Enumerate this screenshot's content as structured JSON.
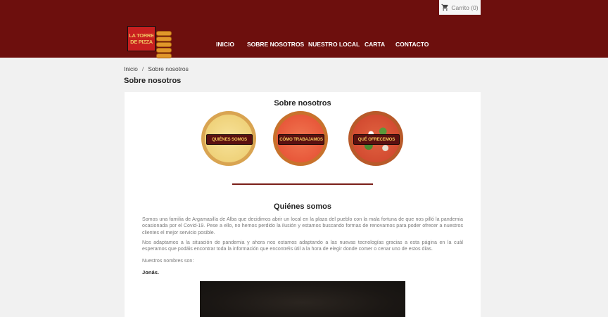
{
  "header": {
    "cart_label": "Carrito (0)",
    "cart_icon": "shopping-cart-icon",
    "logo_line1": "LA TORRE",
    "logo_line2": "DE PIZZA",
    "background_color": "#6d0f0d"
  },
  "nav": {
    "items": [
      {
        "label": "INICIO"
      },
      {
        "label": "SOBRE NOSOTROS"
      },
      {
        "label": "NUESTRO LOCAL"
      },
      {
        "label": "CARTA"
      },
      {
        "label": "CONTACTO"
      }
    ]
  },
  "breadcrumb": {
    "home": "Inicio",
    "separator": "/",
    "current": "Sobre nosotros"
  },
  "page": {
    "title": "Sobre nosotros"
  },
  "content": {
    "heading": "Sobre nosotros",
    "buttons": [
      {
        "label": "QUIÉNES SOMOS"
      },
      {
        "label": "CÓMO TRABAJAMOS"
      },
      {
        "label": "QUÉ OFRECEMOS"
      }
    ],
    "section_title": "Quiénes somos",
    "paragraph1": "Somos una familia de Argamasilla de Alba que decidimos abrir un local en la plaza del pueblo con la mala fortuna de que nos pilló la pandemia ocasionada por el Covid-19. Pese a ello, no hemos perdido la ilusión y estamos buscando formas de renovarnos para poder ofrecer a nuestros clientes el mejor servicio posible.",
    "paragraph2": "Nos adaptamos a la situación de pandemia y ahora nos estamos adaptando a las nuevas tecnologías gracias a esta página en la cuál esperamos que podáis encontrar toda la información que encontréis útil a la hora de elegir donde comer o cenar uno de estos días.",
    "names_intro": "Nuestros nombres son:",
    "name1": "Jonás."
  }
}
